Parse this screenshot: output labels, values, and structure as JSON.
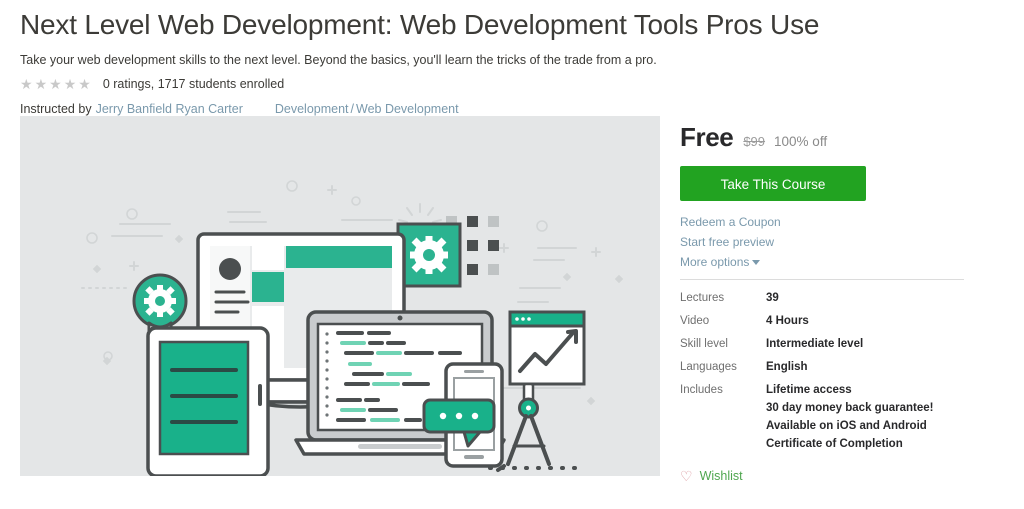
{
  "course": {
    "title": "Next Level Web Development: Web Development Tools Pros Use",
    "subtitle": "Take your web development skills to the next level. Beyond the basics, you'll learn the tricks of the trade from a pro.",
    "rating_stars": 5,
    "rating_filled": 0,
    "rating_text": "0 ratings, 1717 students enrolled",
    "instructed_by_prefix": "Instructed by",
    "instructor_name": "Jerry Banfield Ryan Carter",
    "breadcrumb": {
      "category": "Development",
      "separator": "/",
      "subcategory": "Web Development"
    },
    "image_alt": "web-development-tools-illustration"
  },
  "pricing": {
    "price": "Free",
    "original_price": "$99",
    "discount": "100% off",
    "cta_label": "Take This Course",
    "cta_color": "#22a321"
  },
  "side_links": [
    {
      "label": "Redeem a Coupon",
      "name": "redeem-coupon-link",
      "caret": false
    },
    {
      "label": "Start free preview",
      "name": "start-free-preview-link",
      "caret": false
    },
    {
      "label": "More options",
      "name": "more-options-link",
      "caret": true
    }
  ],
  "details": [
    {
      "label": "Lectures",
      "values": [
        "39"
      ]
    },
    {
      "label": "Video",
      "values": [
        "4 Hours"
      ]
    },
    {
      "label": "Skill level",
      "values": [
        "Intermediate level"
      ]
    },
    {
      "label": "Languages",
      "values": [
        "English"
      ]
    },
    {
      "label": "Includes",
      "values": [
        "Lifetime access",
        "30 day money back guarantee!",
        "Available on iOS and Android",
        "Certificate of Completion"
      ]
    }
  ],
  "wishlist": {
    "label": "Wishlist",
    "icon": "heart-outline-icon",
    "icon_color": "#d9949a",
    "label_color": "#4fa64f"
  },
  "theme": {
    "link_color": "#7a99ac",
    "text_color": "#3c3b37",
    "image_bg": "#e4e6e7",
    "accent_teal": "#2bb390"
  }
}
